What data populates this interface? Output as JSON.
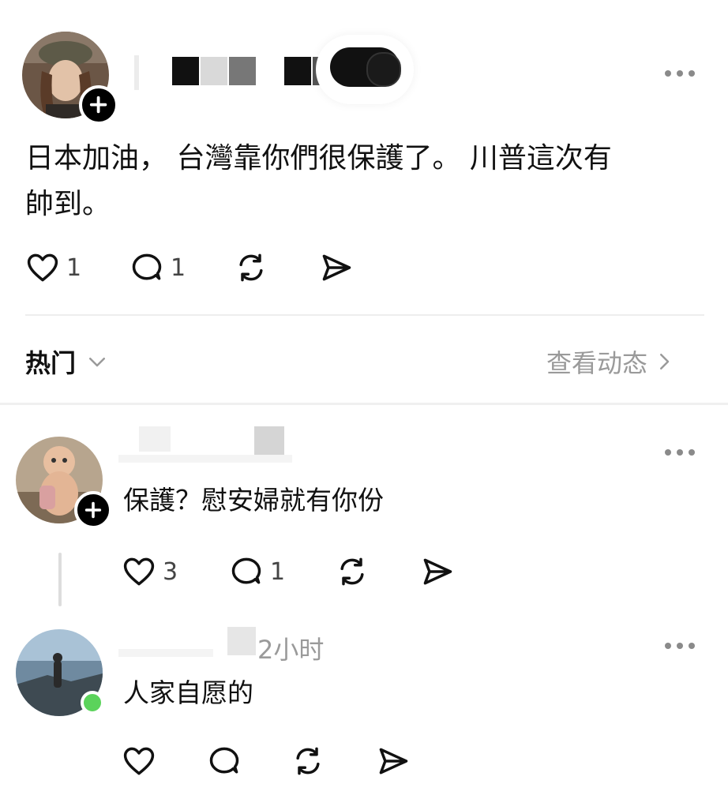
{
  "post": {
    "text_line1": "日本加油， 台灣靠你們很保護了。 川普這次有",
    "text_line2": "帥到。",
    "like_count": "1",
    "reply_count": "1"
  },
  "sort": {
    "label": "热门",
    "view_activity": "查看动态"
  },
  "reply1": {
    "text": "保護？慰安婦就有你份",
    "like_count": "3",
    "reply_count": "1"
  },
  "reply2": {
    "time": "2小时",
    "text": "人家自愿的"
  },
  "colors": {
    "online": "#5bd35b",
    "muted": "#9a9a9a"
  }
}
